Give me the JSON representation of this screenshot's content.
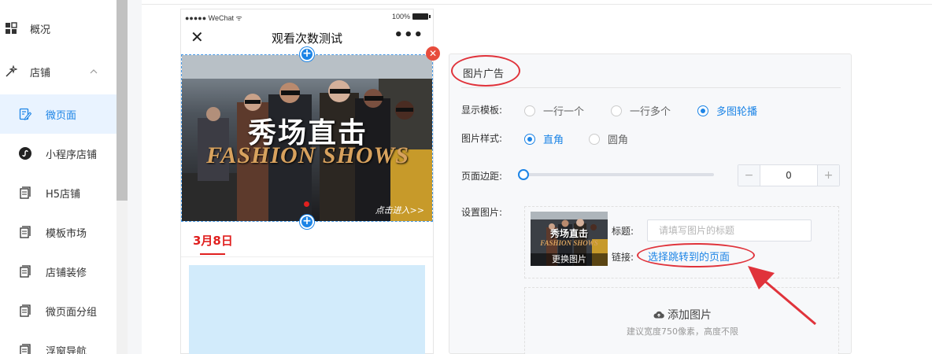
{
  "sidebar": {
    "items": [
      {
        "label": "概况",
        "icon": "grid-icon"
      },
      {
        "label": "店铺",
        "icon": "store-wand-icon"
      },
      {
        "label": "微页面",
        "icon": "edit-page-icon"
      },
      {
        "label": "小程序店铺",
        "icon": "miniprogram-icon"
      },
      {
        "label": "H5店铺",
        "icon": "page-icon"
      },
      {
        "label": "模板市场",
        "icon": "page-icon"
      },
      {
        "label": "店铺装修",
        "icon": "page-icon"
      },
      {
        "label": "微页面分组",
        "icon": "page-icon"
      },
      {
        "label": "浮窗导航",
        "icon": "page-icon"
      }
    ]
  },
  "phone": {
    "status": {
      "carrier": "●●●●● WeChat ᯤ",
      "battery": "100%"
    },
    "nav": {
      "close": "✕",
      "title": "观看次数测试",
      "more": "•••"
    },
    "banner": {
      "title_cn": "秀场直击",
      "title_en": "FASHION SHOWS",
      "enter": "点击进入>>"
    },
    "date_tab": "3月8日"
  },
  "panel": {
    "title": "图片广告",
    "template": {
      "label": "显示模板:",
      "options": [
        "一行一个",
        "一行多个",
        "多图轮播"
      ],
      "selected": "多图轮播"
    },
    "style": {
      "label": "图片样式:",
      "options": [
        "直角",
        "圆角"
      ],
      "selected": "直角"
    },
    "margin": {
      "label": "页面边距:",
      "value": "0",
      "minus": "−",
      "plus": "+"
    },
    "set_image": {
      "label": "设置图片:",
      "change": "更换图片",
      "thumb_cn": "秀场直击",
      "thumb_en": "FASHION SHOWS",
      "title_label": "标题:",
      "title_placeholder": "请填写图片的标题",
      "link_label": "链接:",
      "link_text": "选择跳转到的页面"
    },
    "add_image": {
      "label": "添加图片",
      "hint": "建议宽度750像素，高度不限"
    }
  },
  "colors": {
    "accent": "#1c84e6",
    "annotation": "#e0333b",
    "active_bg": "#e9f3ff"
  }
}
